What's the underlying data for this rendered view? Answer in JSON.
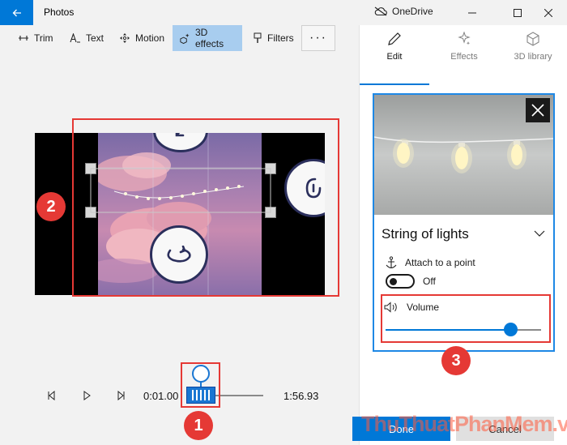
{
  "titlebar": {
    "app_title": "Photos",
    "onedrive_label": "OneDrive",
    "icons": [
      "back-arrow-icon",
      "cloud-icon",
      "minimize-icon",
      "maximize-icon",
      "close-icon"
    ]
  },
  "toolbar": {
    "items": [
      {
        "label": "Trim",
        "icon": "trim-icon"
      },
      {
        "label": "Text",
        "icon": "text-icon"
      },
      {
        "label": "Motion",
        "icon": "motion-icon"
      },
      {
        "label": "3D effects",
        "icon": "3d-effects-icon",
        "active": true
      },
      {
        "label": "Filters",
        "icon": "filters-icon"
      }
    ],
    "more_label": "···"
  },
  "panel": {
    "tabs": [
      {
        "label": "Edit",
        "icon": "pencil-icon",
        "active": true
      },
      {
        "label": "Effects",
        "icon": "sparkle-icon"
      },
      {
        "label": "3D library",
        "icon": "cube-icon"
      }
    ],
    "effect": {
      "title": "String of lights",
      "attach_label": "Attach to a point",
      "attach_state": "Off",
      "volume_label": "Volume",
      "volume_fraction": 0.8
    },
    "done_label": "Done",
    "cancel_label": "Cancel"
  },
  "playback": {
    "current_time": "0:01.00",
    "end_time": "1:56.93"
  },
  "annotations": {
    "badge_1": "1",
    "badge_2": "2",
    "badge_3": "3"
  },
  "watermark": "ThuThuatPhanMem.vn",
  "colors": {
    "accent": "#0078d7",
    "annotation_red": "#e53935"
  }
}
